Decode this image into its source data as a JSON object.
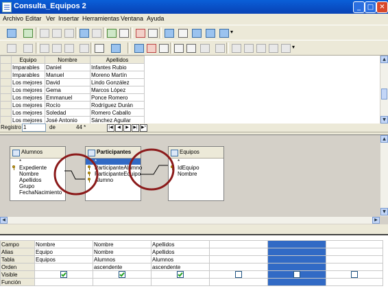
{
  "window": {
    "title": "Consulta_Equipos 2",
    "minimize": "_",
    "maximize": "□",
    "close": "✕"
  },
  "menu": [
    "Archivo",
    "Editar",
    "Ver",
    "Insertar",
    "Herramientas",
    "Ventana",
    "Ayuda"
  ],
  "results": {
    "headers": [
      "Equipo",
      "Nombre",
      "Apellidos"
    ],
    "rows": [
      [
        "Imparables",
        "Daniel",
        "Infantes Rubio"
      ],
      [
        "Imparables",
        "Manuel",
        "Moreno Martín"
      ],
      [
        "Los mejores",
        "David",
        "Lindo González"
      ],
      [
        "Los mejores",
        "Gema",
        "Marcos López"
      ],
      [
        "Los mejores",
        "Emmanuel",
        "Ponce Romero"
      ],
      [
        "Los mejores",
        "Rocío",
        "Rodríguez Durán"
      ],
      [
        "Los mejores",
        "Soledad",
        "Romero Caballo"
      ],
      [
        "Los mejores",
        "José Antonio",
        "Sánchez Aguilar"
      ]
    ]
  },
  "navigator": {
    "label": "Registro",
    "current": "1",
    "of_label": "de",
    "total": "44 *"
  },
  "tables": {
    "alumnos": {
      "title": "Alumnos",
      "fields": [
        "*",
        "Expediente",
        "Nombre",
        "Apellidos",
        "Grupo",
        "FechaNacimiento"
      ]
    },
    "participantes": {
      "title": "Participantes",
      "fields": [
        "*",
        "ParticipanteAlumno",
        "ParticipanteEquipo",
        "Alumno"
      ]
    },
    "equipos": {
      "title": "Equipos",
      "fields": [
        "*",
        "IdEquipo",
        "Nombre"
      ]
    }
  },
  "qbe": {
    "row_labels": [
      "Campo",
      "Alias",
      "Tabla",
      "Orden",
      "Visible",
      "Función"
    ],
    "columns": [
      {
        "campo": "Nombre",
        "alias": "Equipo",
        "tabla": "Equipos",
        "orden": "",
        "visible": true
      },
      {
        "campo": "Nombre",
        "alias": "Nombre",
        "tabla": "Alumnos",
        "orden": "ascendente",
        "visible": true
      },
      {
        "campo": "Apellidos",
        "alias": "Apellidos",
        "tabla": "Alumnos",
        "orden": "ascendente",
        "visible": true
      },
      {
        "campo": "",
        "alias": "",
        "tabla": "",
        "orden": "",
        "visible": false
      },
      {
        "campo": "",
        "alias": "",
        "tabla": "",
        "orden": "",
        "visible": false,
        "selected": true
      },
      {
        "campo": "",
        "alias": "",
        "tabla": "",
        "orden": "",
        "visible": false
      }
    ]
  },
  "colors": {
    "titlebar": "#0a5fd8",
    "selection": "#316ac5",
    "annotation_circle": "#8b1a1a"
  }
}
